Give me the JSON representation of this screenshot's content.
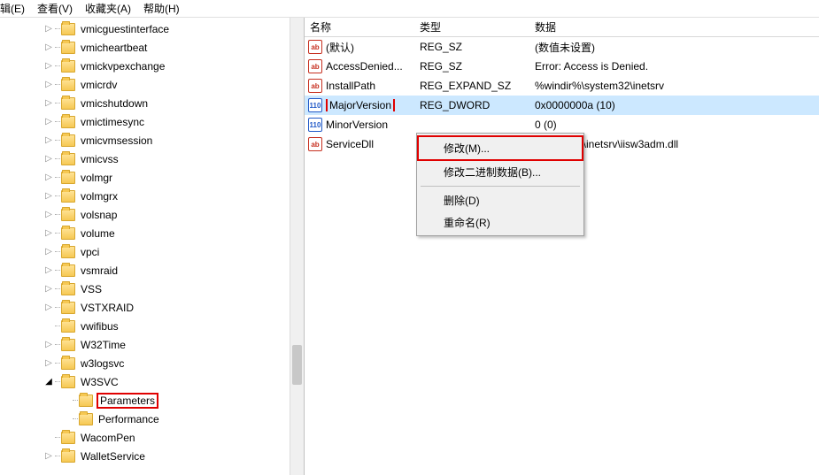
{
  "menubar": {
    "edit": "辑(E)",
    "view": "查看(V)",
    "favorites": "收藏夹(A)",
    "help": "帮助(H)"
  },
  "tree": {
    "items": [
      {
        "label": "vmicguestinterface",
        "depth": 2,
        "exp": ">"
      },
      {
        "label": "vmicheartbeat",
        "depth": 2,
        "exp": ">"
      },
      {
        "label": "vmickvpexchange",
        "depth": 2,
        "exp": ">"
      },
      {
        "label": "vmicrdv",
        "depth": 2,
        "exp": ">"
      },
      {
        "label": "vmicshutdown",
        "depth": 2,
        "exp": ">"
      },
      {
        "label": "vmictimesync",
        "depth": 2,
        "exp": ">"
      },
      {
        "label": "vmicvmsession",
        "depth": 2,
        "exp": ">"
      },
      {
        "label": "vmicvss",
        "depth": 2,
        "exp": ">"
      },
      {
        "label": "volmgr",
        "depth": 2,
        "exp": ">"
      },
      {
        "label": "volmgrx",
        "depth": 2,
        "exp": ">"
      },
      {
        "label": "volsnap",
        "depth": 2,
        "exp": ">"
      },
      {
        "label": "volume",
        "depth": 2,
        "exp": ">"
      },
      {
        "label": "vpci",
        "depth": 2,
        "exp": ">"
      },
      {
        "label": "vsmraid",
        "depth": 2,
        "exp": ">"
      },
      {
        "label": "VSS",
        "depth": 2,
        "exp": ">"
      },
      {
        "label": "VSTXRAID",
        "depth": 2,
        "exp": ">"
      },
      {
        "label": "vwifibus",
        "depth": 2,
        "exp": ""
      },
      {
        "label": "W32Time",
        "depth": 2,
        "exp": ">"
      },
      {
        "label": "w3logsvc",
        "depth": 2,
        "exp": ">"
      },
      {
        "label": "W3SVC",
        "depth": 2,
        "exp": "v"
      },
      {
        "label": "Parameters",
        "depth": 3,
        "exp": "",
        "highlight": true
      },
      {
        "label": "Performance",
        "depth": 3,
        "exp": ""
      },
      {
        "label": "WacomPen",
        "depth": 2,
        "exp": ""
      },
      {
        "label": "WalletService",
        "depth": 2,
        "exp": ">"
      }
    ]
  },
  "list": {
    "header": {
      "name": "名称",
      "type": "类型",
      "data": "数据"
    },
    "rows": [
      {
        "icon": "str",
        "name": "(默认)",
        "type": "REG_SZ",
        "data": "(数值未设置)"
      },
      {
        "icon": "str",
        "name": "AccessDenied...",
        "type": "REG_SZ",
        "data": "Error: Access is Denied."
      },
      {
        "icon": "str",
        "name": "InstallPath",
        "type": "REG_EXPAND_SZ",
        "data": "%windir%\\system32\\inetsrv"
      },
      {
        "icon": "bin",
        "name": "MajorVersion",
        "type": "REG_DWORD",
        "data": "0x0000000a (10)",
        "selected": true,
        "highlight": true
      },
      {
        "icon": "bin",
        "name": "MinorVersion",
        "type": "",
        "data": "0 (0)"
      },
      {
        "icon": "str",
        "name": "ServiceDll",
        "type": "",
        "data": "\\system32\\inetsrv\\iisw3adm.dll"
      }
    ]
  },
  "context_menu": {
    "modify": "修改(M)...",
    "modify_binary": "修改二进制数据(B)...",
    "delete": "删除(D)",
    "rename": "重命名(R)"
  }
}
